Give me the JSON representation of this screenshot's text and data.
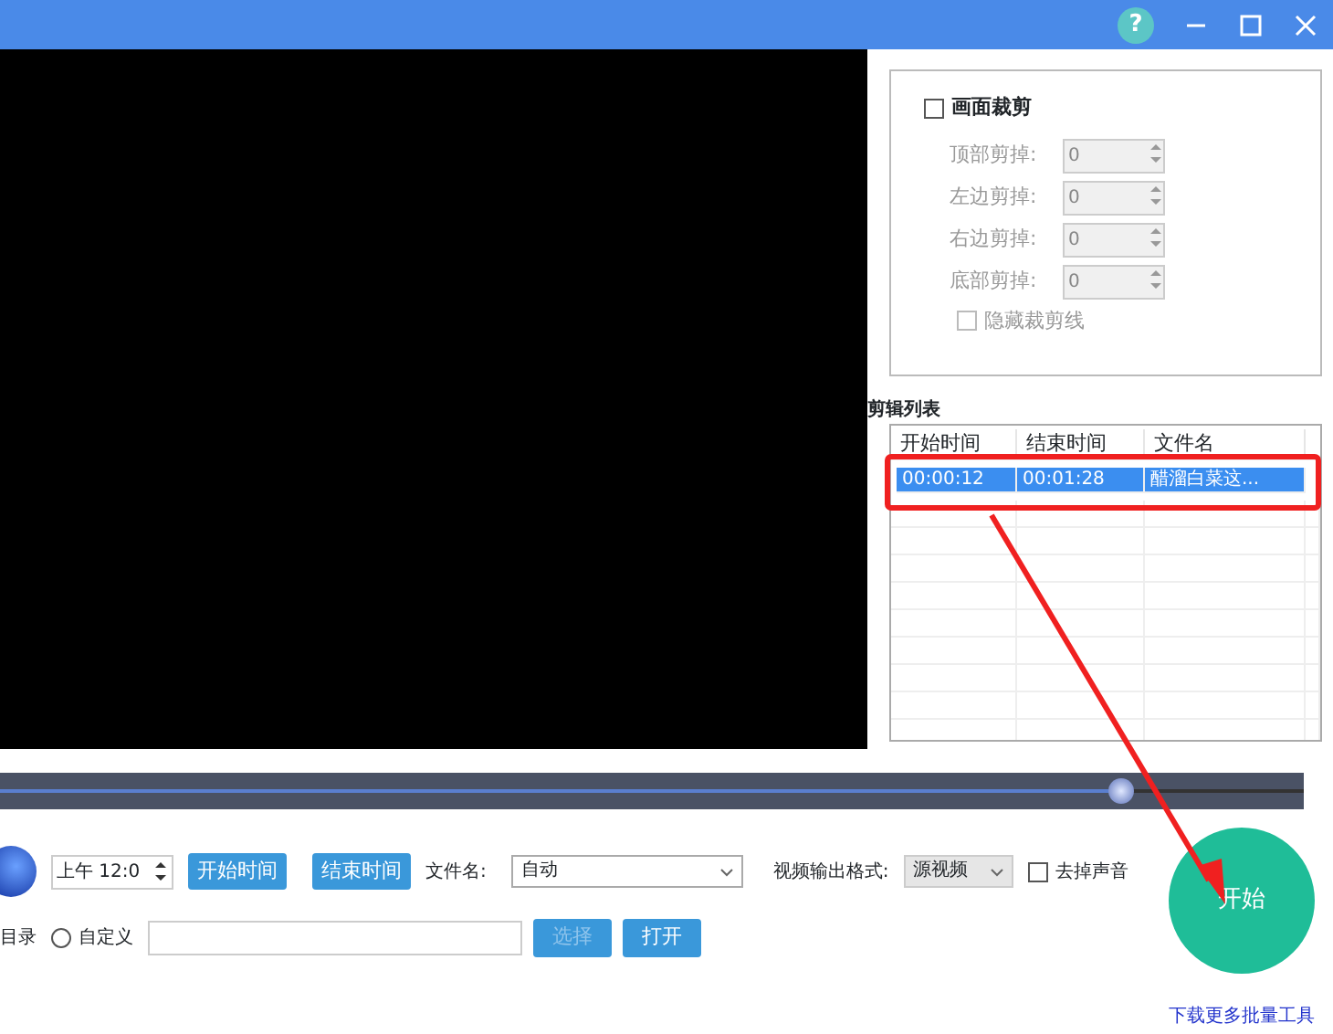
{
  "window": {
    "help": "?"
  },
  "crop": {
    "label": "画面裁剪",
    "checked": false,
    "fields": [
      {
        "label": "顶部剪掉:",
        "value": "0",
        "disabled": true
      },
      {
        "label": "左边剪掉:",
        "value": "0",
        "disabled": true
      },
      {
        "label": "右边剪掉:",
        "value": "0",
        "disabled": true
      },
      {
        "label": "底部剪掉:",
        "value": "0",
        "disabled": true
      }
    ],
    "hide_lines": {
      "label": "隐藏裁剪线",
      "checked": false,
      "disabled": true
    }
  },
  "edit_list": {
    "title": "剪辑列表",
    "columns": [
      "开始时间",
      "结束时间",
      "文件名"
    ],
    "rows": [
      {
        "cells": [
          "00:00:12",
          "00:01:28",
          "醋溜白菜这..."
        ],
        "selected": true
      }
    ]
  },
  "timeline": {
    "level": 0.86
  },
  "controls": {
    "time_field": {
      "value": "上午 12:0"
    },
    "start_time_button": "开始时间",
    "end_time_button": "结束时间",
    "filename": {
      "label": "文件名:",
      "value": "自动"
    },
    "format": {
      "label": "视频输出格式:",
      "value": "源视频"
    },
    "mute": {
      "label": "去掉声音",
      "checked": false
    }
  },
  "output": {
    "label": "目录",
    "custom": {
      "label": "自定义",
      "selected": false
    },
    "select_button": {
      "label": "选择",
      "disabled": true
    },
    "open_button": {
      "label": "打开",
      "disabled": false
    }
  },
  "start_button": "开始",
  "more_link": "下载更多批量工具"
}
